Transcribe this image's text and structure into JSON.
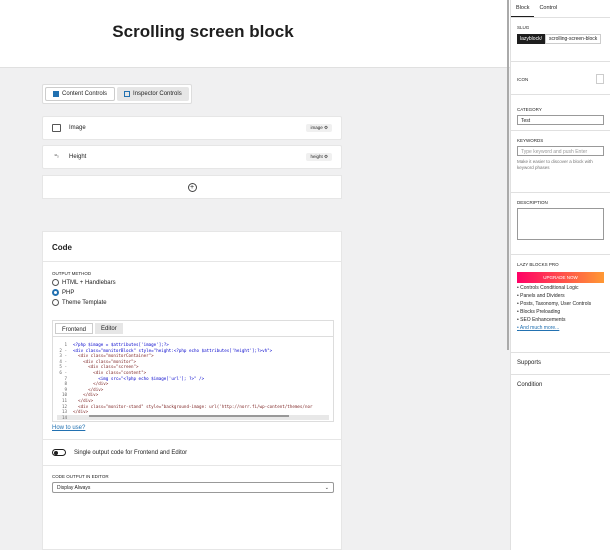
{
  "page": {
    "title": "Scrolling screen block"
  },
  "control_tabs": [
    {
      "label": "Content Controls"
    },
    {
      "label": "Inspector Controls"
    }
  ],
  "controls": [
    {
      "label": "Image",
      "badge": "image ⚙"
    },
    {
      "label": "Height",
      "badge": "height ⚙"
    }
  ],
  "code": {
    "heading": "Code",
    "output_method_label": "OUTPUT METHOD",
    "methods": [
      "HTML + Handlebars",
      "PHP",
      "Theme Template"
    ],
    "selected_method": "PHP",
    "editor_tabs": [
      "Frontend",
      "Editor"
    ],
    "lines": [
      {
        "n": "1",
        "t": "<?php $image = $attributes['image'];?>"
      },
      {
        "n": "2 -",
        "t": "<div class=\"monitorBlock\" style=\"height:<?php echo $attributes['height'];?>vh\">"
      },
      {
        "n": "3 -",
        "t": "  <div class=\"monitorContainer\">"
      },
      {
        "n": "4 -",
        "t": "    <div class=\"monitor\">"
      },
      {
        "n": "5 -",
        "t": "      <div class=\"screen\">"
      },
      {
        "n": "6 -",
        "t": "        <div class=\"content\">"
      },
      {
        "n": "7",
        "t": "          <img src=\"<?php echo $image['url']; ?>\" />"
      },
      {
        "n": "8",
        "t": "        </div>"
      },
      {
        "n": "9",
        "t": "      </div>"
      },
      {
        "n": "10",
        "t": "    </div>"
      },
      {
        "n": "11",
        "t": "  </div>"
      },
      {
        "n": "12",
        "t": "  <div class=\"monitor-stand\" style=\"background-image: url('http://norr.fi/wp-content/themes/nor"
      },
      {
        "n": "13",
        "t": "</div>"
      },
      {
        "n": "14",
        "t": ""
      }
    ],
    "how_to_use": "How to use?",
    "single_output": "Single output code for Frontend and Editor",
    "code_output_label": "CODE OUTPUT IN EDITOR",
    "code_output_value": "Display Always"
  },
  "sidebar": {
    "tabs": [
      "Block",
      "Control"
    ],
    "slug_label": "SLUG",
    "slug_prefix": "lazyblock/",
    "slug_value": "scrolling-screen-block",
    "icon_label": "ICON",
    "category_label": "CATEGORY",
    "category_value": "Test",
    "keywords_label": "KEYWORDS",
    "keywords_placeholder": "Type keyword and push Enter",
    "keywords_help": "Make it easier to discover a block with keyword phases",
    "description_label": "DESCRIPTION",
    "pro_label": "LAZY BLOCKS PRO",
    "upgrade": "UPGRADE NOW",
    "features": [
      "Controls Conditional Logic",
      "Panels and Dividers",
      "Posts, Taxonomy, User Controls",
      "Blocks Preloading",
      "SEO Enhancements"
    ],
    "more": "And much more...",
    "supports": "Supports",
    "condition": "Condition"
  }
}
